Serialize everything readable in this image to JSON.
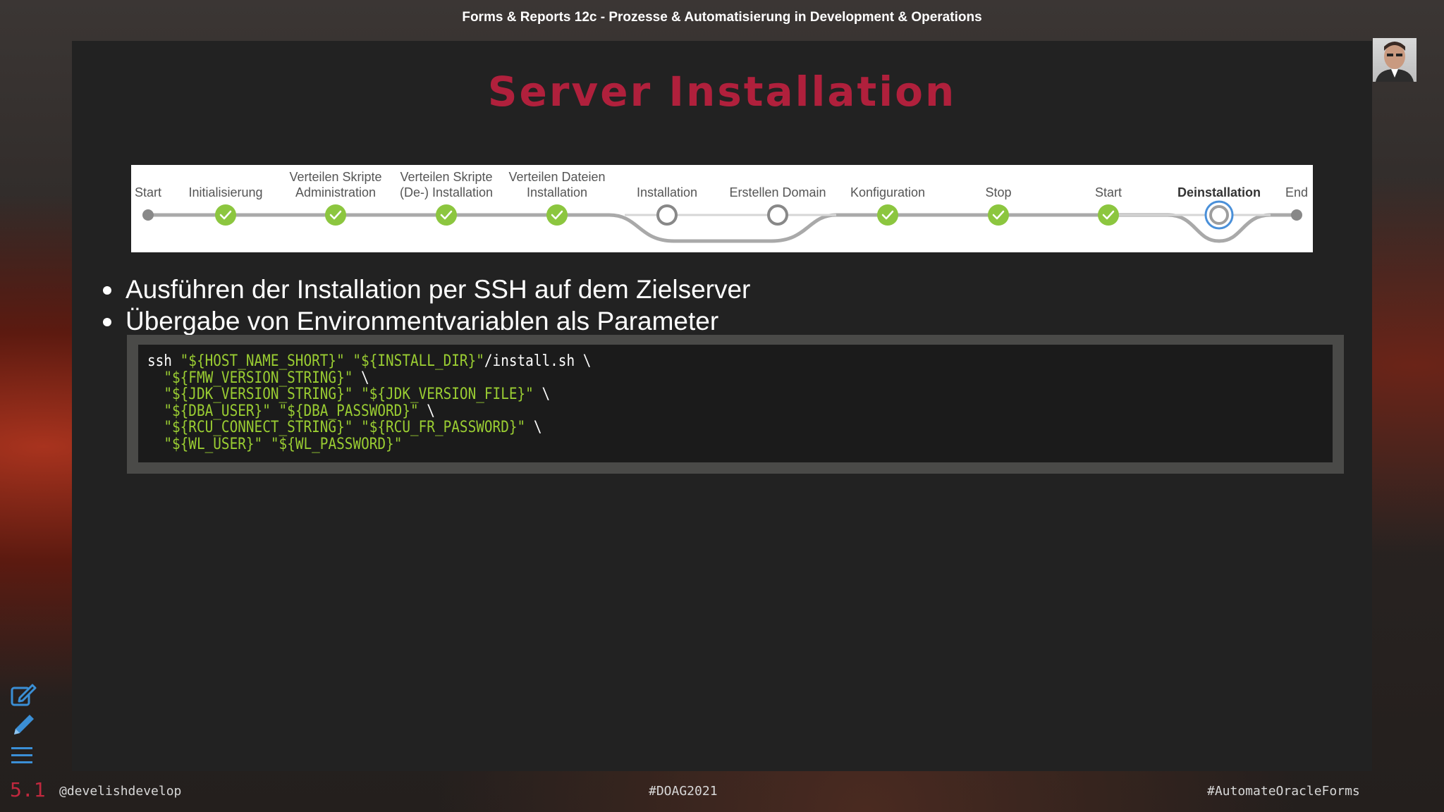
{
  "header": {
    "title": "Forms & Reports 12c - Prozesse & Automatisierung in Development & Operations"
  },
  "slide": {
    "title": "Server Installation",
    "pipeline": {
      "stages": [
        {
          "label": "Start",
          "status": "start"
        },
        {
          "label": "Initialisierung",
          "status": "done"
        },
        {
          "label": "Verteilen Skripte Administration",
          "status": "done"
        },
        {
          "label": "Verteilen Skripte (De-) Installation",
          "status": "done"
        },
        {
          "label": "Verteilen Dateien Installation",
          "status": "done"
        },
        {
          "label": "Installation",
          "status": "pending"
        },
        {
          "label": "Erstellen Domain",
          "status": "pending"
        },
        {
          "label": "Konfiguration",
          "status": "done"
        },
        {
          "label": "Stop",
          "status": "done"
        },
        {
          "label": "Start",
          "status": "done"
        },
        {
          "label": "Deinstallation",
          "status": "active"
        },
        {
          "label": "End",
          "status": "end"
        }
      ]
    },
    "bullets": [
      "Ausführen der Installation per SSH auf dem Zielserver",
      "Übergabe von Environmentvariablen als Parameter"
    ],
    "code": [
      "ssh \"${HOST_NAME_SHORT}\" \"${INSTALL_DIR}\"/install.sh \\",
      "  \"${FMW_VERSION_STRING}\" \\",
      "  \"${JDK_VERSION_STRING}\" \"${JDK_VERSION_FILE}\" \\",
      "  \"${DBA_USER}\" \"${DBA_PASSWORD}\" \\",
      "  \"${RCU_CONNECT_STRING}\" \"${RCU_FR_PASSWORD}\" \\",
      "  \"${WL_USER}\" \"${WL_PASSWORD}\""
    ]
  },
  "footer": {
    "slide_number": "5.1",
    "handle": "@develishdevelop",
    "hashtag_center": "#DOAG2021",
    "hashtag_right": "#AutomateOracleForms"
  },
  "colors": {
    "title": "#b0203c",
    "done": "#8cc63f",
    "pending": "#888888",
    "active": "#4a90d9",
    "code_string": "#9acd32"
  },
  "icons": [
    "edit-icon",
    "pencil-icon",
    "menu-icon",
    "presenter-avatar"
  ]
}
